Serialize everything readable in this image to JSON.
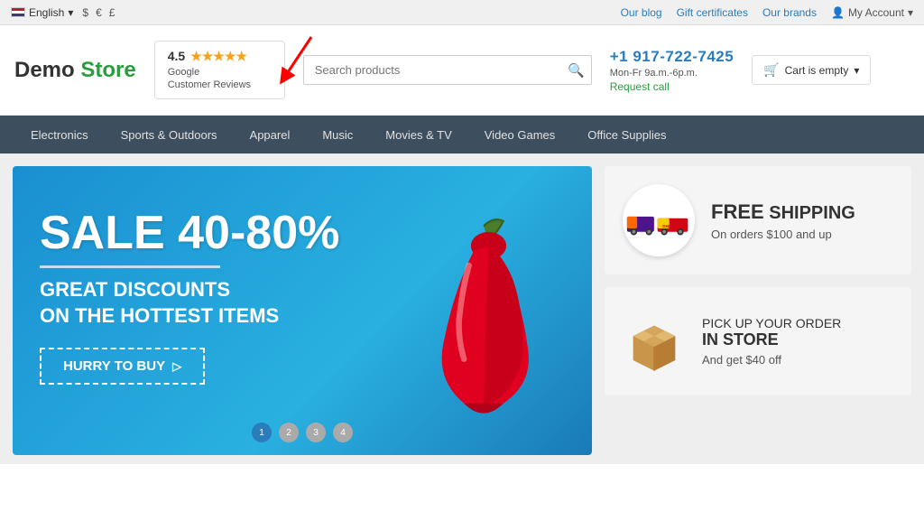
{
  "topbar": {
    "language": "English",
    "currency_usd": "$",
    "currency_eur": "€",
    "currency_gbp": "£",
    "our_blog": "Our blog",
    "gift_certificates": "Gift certificates",
    "our_brands": "Our brands",
    "my_account": "My Account"
  },
  "header": {
    "logo_demo": "Demo",
    "logo_store": "Store",
    "rating": "4.5",
    "stars": "★★★★★",
    "reviews_label": "Google\nCustomer Reviews",
    "search_placeholder": "Search products",
    "phone": "+1 917-",
    "phone_bold": "722-7425",
    "hours": "Mon-Fr 9a.m.-6p.m.",
    "request_call": "Request call",
    "cart_label": "Cart is empty"
  },
  "nav": {
    "items": [
      {
        "label": "Electronics"
      },
      {
        "label": "Sports & Outdoors"
      },
      {
        "label": "Apparel"
      },
      {
        "label": "Music"
      },
      {
        "label": "Movies & TV"
      },
      {
        "label": "Video Games"
      },
      {
        "label": "Office Supplies"
      }
    ]
  },
  "hero": {
    "sale_text": "SALE 40-80%",
    "subtitle_line1": "GREAT DISCOUNTS",
    "subtitle_line2": "ON THE HOTTEST ITEMS",
    "cta_button": "HURRY TO BUY",
    "dots": [
      "1",
      "2",
      "3",
      "4"
    ]
  },
  "sidebar": {
    "card1": {
      "title_free": "FREE",
      "title_rest": " SHIPPING",
      "subtitle": "On orders $100 and up"
    },
    "card2": {
      "title_line1": "PICK UP YOUR ORDER",
      "title_line2_highlight": "IN STORE",
      "subtitle": "And get $40 off"
    }
  }
}
